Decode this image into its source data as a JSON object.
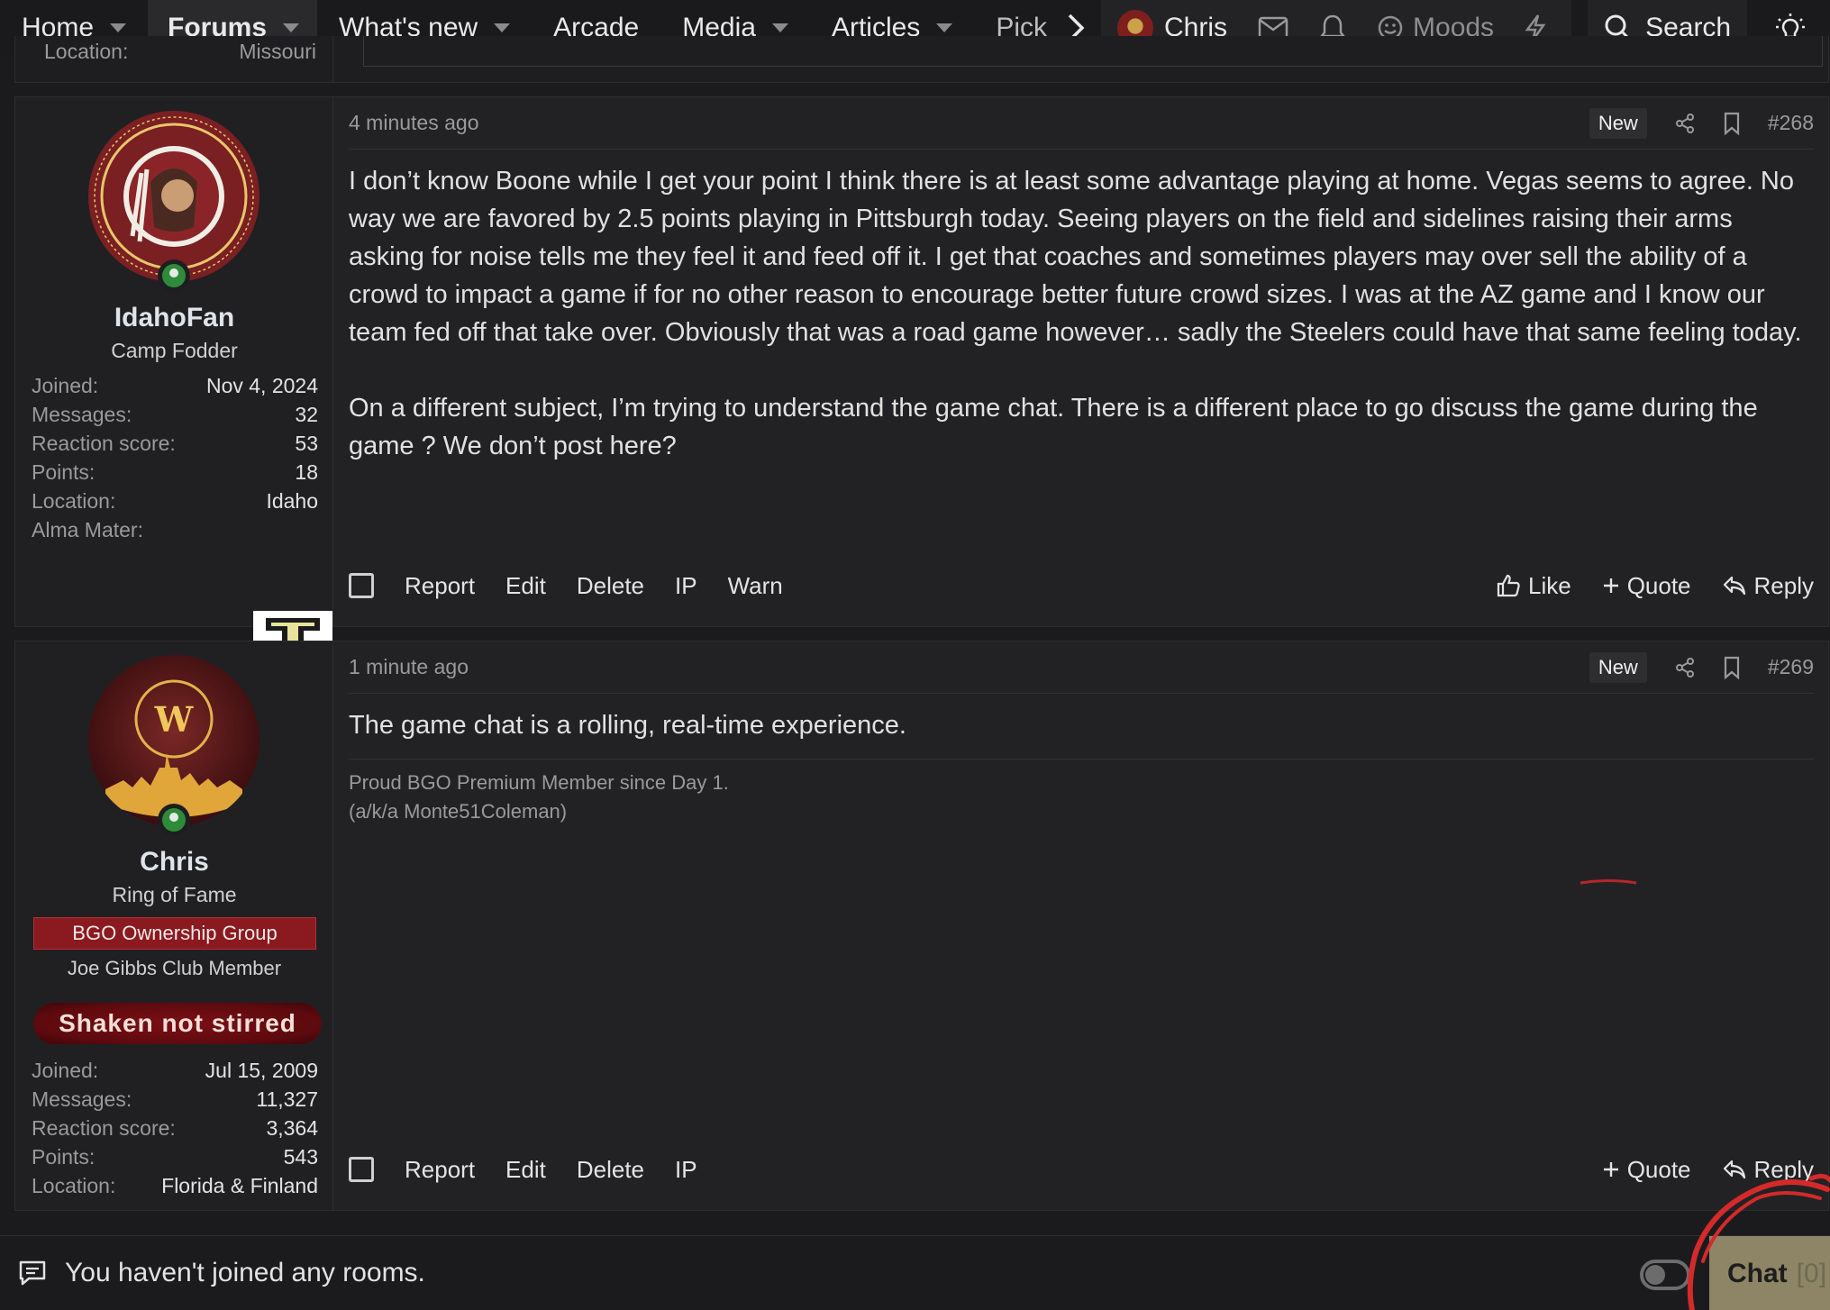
{
  "nav": {
    "items": [
      {
        "label": "Home",
        "caret": true
      },
      {
        "label": "Forums",
        "caret": true,
        "active": true
      },
      {
        "label": "What's new",
        "caret": true
      },
      {
        "label": "Arcade",
        "caret": false
      },
      {
        "label": "Media",
        "caret": true
      },
      {
        "label": "Articles",
        "caret": true
      },
      {
        "label": "Pick",
        "caret": false
      }
    ],
    "user_name": "Chris",
    "moods_label": "Moods",
    "search_label": "Search"
  },
  "prev_post": {
    "location_label": "Location:",
    "location_value": "Missouri"
  },
  "posts": [
    {
      "user": {
        "name": "IdahoFan",
        "title": "Camp Fodder",
        "stats": [
          {
            "k": "Joined:",
            "v": "Nov 4, 2024"
          },
          {
            "k": "Messages:",
            "v": "32"
          },
          {
            "k": "Reaction score:",
            "v": "53"
          },
          {
            "k": "Points:",
            "v": "18"
          },
          {
            "k": "Location:",
            "v": "Idaho"
          },
          {
            "k": "Alma Mater:",
            "v": ""
          }
        ]
      },
      "time": "4 minutes ago",
      "badge": "New",
      "number": "#268",
      "paragraphs": [
        "I don’t know Boone while I get your point I think there is at least some advantage playing at home. Vegas seems to agree. No way we are favored by 2.5 points playing in Pittsburgh today. Seeing players on the field and sidelines raising their arms asking for noise tells me they feel it and feed off it. I get that coaches and sometimes players may over sell the ability of a crowd to impact a game if for no other reason to encourage better future crowd sizes. I was at the AZ game and I know our team fed off that take over. Obviously that was a road game however… sadly the Steelers could have that same feeling today.",
        "On a different subject, I’m trying to understand the game chat. There is a different place to go discuss the game during the game ? We don’t post here?"
      ],
      "actions": [
        "Report",
        "Edit",
        "Delete",
        "IP",
        "Warn"
      ],
      "right_actions": {
        "like": "Like",
        "quote": "Quote",
        "reply": "Reply"
      }
    },
    {
      "user": {
        "name": "Chris",
        "title": "Ring of Fame",
        "group": "BGO Ownership Group",
        "club": "Joe Gibbs Club Member",
        "banner": "Shaken not stirred",
        "stats": [
          {
            "k": "Joined:",
            "v": "Jul 15, 2009"
          },
          {
            "k": "Messages:",
            "v": "11,327"
          },
          {
            "k": "Reaction score:",
            "v": "3,364"
          },
          {
            "k": "Points:",
            "v": "543"
          },
          {
            "k": "Location:",
            "v": "Florida & Finland"
          }
        ]
      },
      "time": "1 minute ago",
      "badge": "New",
      "number": "#269",
      "paragraphs": [
        "The game chat is a rolling, real-time experience."
      ],
      "signature": [
        "Proud BGO Premium Member since Day 1.",
        "(a/k/a Monte51Coleman)"
      ],
      "actions": [
        "Report",
        "Edit",
        "Delete",
        "IP"
      ],
      "right_actions": {
        "quote": "Quote",
        "reply": "Reply"
      }
    }
  ],
  "chatbar": {
    "message": "You haven't joined any rooms.",
    "button": "Chat",
    "count": "[0]"
  },
  "colors": {
    "background": "#1b1b1d",
    "post_bg": "#222224",
    "group_banner": "#8a1a1f",
    "chat_button": "#8d8565",
    "online": "#2e8b3a",
    "annotation": "#d42a2a"
  }
}
